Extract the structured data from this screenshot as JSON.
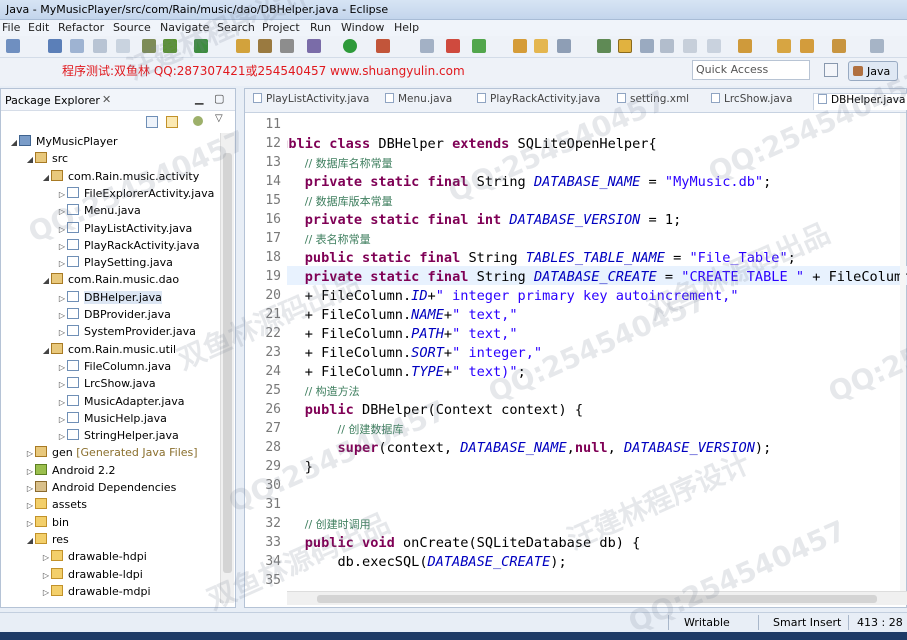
{
  "window": {
    "title": "Java - MyMusicPlayer/src/com/Rain/music/dao/DBHelper.java - Eclipse"
  },
  "menu": [
    "File",
    "Edit",
    "Refactor",
    "Source",
    "Navigate",
    "Search",
    "Project",
    "Run",
    "Window",
    "Help"
  ],
  "banner": {
    "text": "程序测试:双鱼林 QQ:287307421或254540457 www.shuangyulin.com"
  },
  "quick_access": {
    "placeholder": "Quick Access"
  },
  "perspective": {
    "label": "Java"
  },
  "package_explorer": {
    "title": "Package Explorer",
    "tree": [
      {
        "label": "MyMusicPlayer",
        "icon": "project-icon",
        "level": 0,
        "expanded": true
      },
      {
        "label": "src",
        "icon": "source-folder-icon",
        "level": 1,
        "expanded": true
      },
      {
        "label": "com.Rain.music.activity",
        "icon": "package-icon",
        "level": 2,
        "expanded": true
      },
      {
        "label": "FileExplorerActivity.java",
        "icon": "java-file-icon",
        "level": 3
      },
      {
        "label": "Menu.java",
        "icon": "java-file-icon",
        "level": 3
      },
      {
        "label": "PlayListActivity.java",
        "icon": "java-file-icon",
        "level": 3
      },
      {
        "label": "PlayRackActivity.java",
        "icon": "java-file-icon",
        "level": 3
      },
      {
        "label": "PlaySetting.java",
        "icon": "java-file-icon",
        "level": 3
      },
      {
        "label": "com.Rain.music.dao",
        "icon": "package-icon",
        "level": 2,
        "expanded": true
      },
      {
        "label": "DBHelper.java",
        "icon": "java-file-icon",
        "level": 3
      },
      {
        "label": "DBProvider.java",
        "icon": "java-file-icon",
        "level": 3
      },
      {
        "label": "SystemProvider.java",
        "icon": "java-file-icon",
        "level": 3
      },
      {
        "label": "com.Rain.music.util",
        "icon": "package-icon",
        "level": 2,
        "expanded": true
      },
      {
        "label": "FileColumn.java",
        "icon": "java-file-icon",
        "level": 3
      },
      {
        "label": "LrcShow.java",
        "icon": "java-file-icon",
        "level": 3
      },
      {
        "label": "MusicAdapter.java",
        "icon": "java-file-icon",
        "level": 3
      },
      {
        "label": "MusicHelp.java",
        "icon": "java-file-icon",
        "level": 3
      },
      {
        "label": "StringHelper.java",
        "icon": "java-file-icon",
        "level": 3
      },
      {
        "label": "gen [Generated Java Files]",
        "icon": "source-folder-icon",
        "level": 1
      },
      {
        "label": "Android 2.2",
        "icon": "android-library-icon",
        "level": 1
      },
      {
        "label": "Android Dependencies",
        "icon": "library-icon",
        "level": 1
      },
      {
        "label": "assets",
        "icon": "folder-icon",
        "level": 1
      },
      {
        "label": "bin",
        "icon": "folder-icon",
        "level": 1
      },
      {
        "label": "res",
        "icon": "folder-icon",
        "level": 1,
        "expanded": true
      },
      {
        "label": "drawable-hdpi",
        "icon": "folder-icon",
        "level": 2
      },
      {
        "label": "drawable-ldpi",
        "icon": "folder-icon",
        "level": 2
      },
      {
        "label": "drawable-mdpi",
        "icon": "folder-icon",
        "level": 2
      }
    ]
  },
  "editor": {
    "tabs": [
      "PlayListActivity.java",
      "Menu.java",
      "PlayRackActivity.java",
      "setting.xml",
      "LrcShow.java",
      "DBHelper.java"
    ],
    "active_tab": "DBHelper.java",
    "lines": [
      {
        "n": "11",
        "code": ""
      },
      {
        "n": "12",
        "code": "public class DBHelper extends SQLiteOpenHelper{"
      },
      {
        "n": "13",
        "code": "    // 数据库名称常量"
      },
      {
        "n": "14",
        "code": "    private static final String DATABASE_NAME = \"MyMusic.db\";"
      },
      {
        "n": "15",
        "code": "    // 数据库版本常量"
      },
      {
        "n": "16",
        "code": "    private static final int DATABASE_VERSION = 1;"
      },
      {
        "n": "17",
        "code": "    // 表名称常量"
      },
      {
        "n": "18",
        "code": "    public static final String TABLES_TABLE_NAME = \"File_Table\";"
      },
      {
        "n": "19",
        "code": "    private static final String DATABASE_CREATE = \"CREATE TABLE \" + FileColumn.TABLE"
      },
      {
        "n": "20",
        "code": "    + FileColumn.ID+\" integer primary key autoincrement,\""
      },
      {
        "n": "21",
        "code": "    + FileColumn.NAME+\" text,\""
      },
      {
        "n": "22",
        "code": "    + FileColumn.PATH+\" text,\""
      },
      {
        "n": "23",
        "code": "    + FileColumn.SORT+\" integer,\""
      },
      {
        "n": "24",
        "code": "    + FileColumn.TYPE+\" text)\";"
      },
      {
        "n": "25",
        "code": "    // 构造方法"
      },
      {
        "n": "26",
        "code": "    public DBHelper(Context context) {"
      },
      {
        "n": "27",
        "code": "        // 创建数据库"
      },
      {
        "n": "28",
        "code": "        super(context, DATABASE_NAME,null, DATABASE_VERSION);"
      },
      {
        "n": "29",
        "code": "    }"
      },
      {
        "n": "30",
        "code": ""
      },
      {
        "n": "31",
        "code": ""
      },
      {
        "n": "32",
        "code": "    // 创建时调用"
      },
      {
        "n": "33",
        "code": "    public void onCreate(SQLiteDatabase db) {"
      },
      {
        "n": "34",
        "code": "        db.execSQL(DATABASE_CREATE);"
      },
      {
        "n": "35",
        "code": ""
      }
    ]
  },
  "status": {
    "writable": "Writable",
    "insert_mode": "Smart Insert",
    "position": "413 : 28"
  },
  "watermarks": [
    "双鱼林源码出品",
    "QQ:254540457",
    "汪建林程序设计"
  ]
}
